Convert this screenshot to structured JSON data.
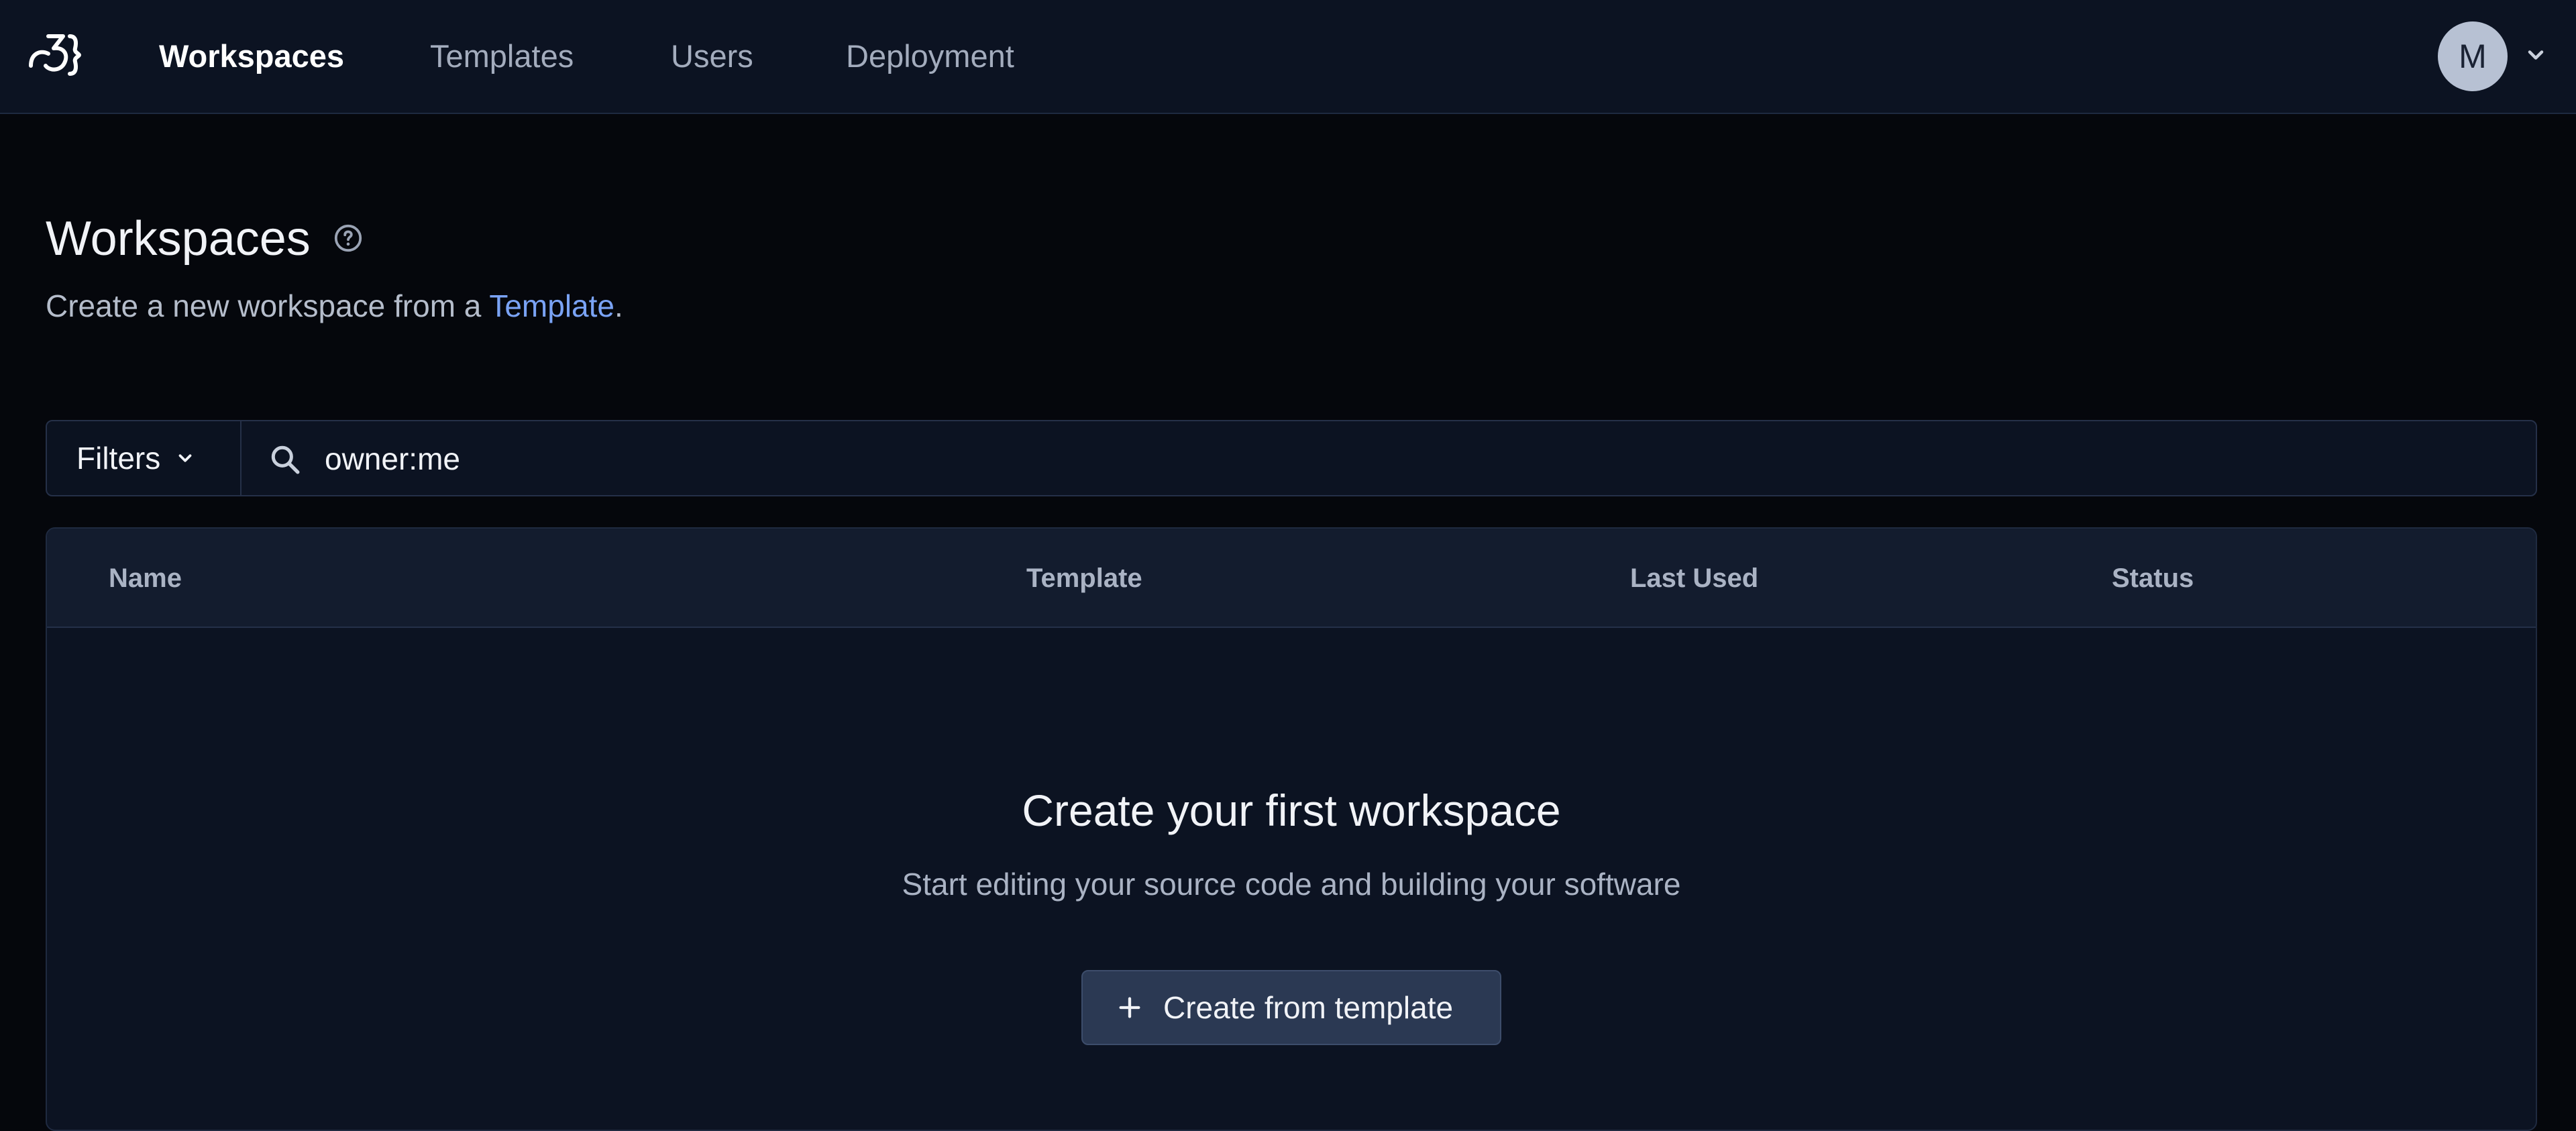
{
  "nav": {
    "items": [
      {
        "label": "Workspaces",
        "active": true
      },
      {
        "label": "Templates",
        "active": false
      },
      {
        "label": "Users",
        "active": false
      },
      {
        "label": "Deployment",
        "active": false
      }
    ],
    "avatar_initial": "M"
  },
  "header": {
    "title": "Workspaces",
    "subtitle_prefix": "Create a new workspace from a ",
    "subtitle_link": "Template",
    "subtitle_suffix": "."
  },
  "filters": {
    "label": "Filters",
    "search_value": "owner:me"
  },
  "table": {
    "columns": [
      "Name",
      "Template",
      "Last Used",
      "Status"
    ]
  },
  "empty_state": {
    "title": "Create your first workspace",
    "subtitle": "Start editing your source code and building your software",
    "button_label": "Create from template"
  },
  "colors": {
    "background": "#05070c",
    "navbar": "#0c1322",
    "accent_link": "#7aa3f5",
    "button": "#2b3953"
  },
  "icons": {
    "logo": "coder-logo-icon",
    "help": "help-circle-icon",
    "search": "search-icon",
    "chevron": "chevron-down-icon",
    "plus": "plus-icon"
  }
}
